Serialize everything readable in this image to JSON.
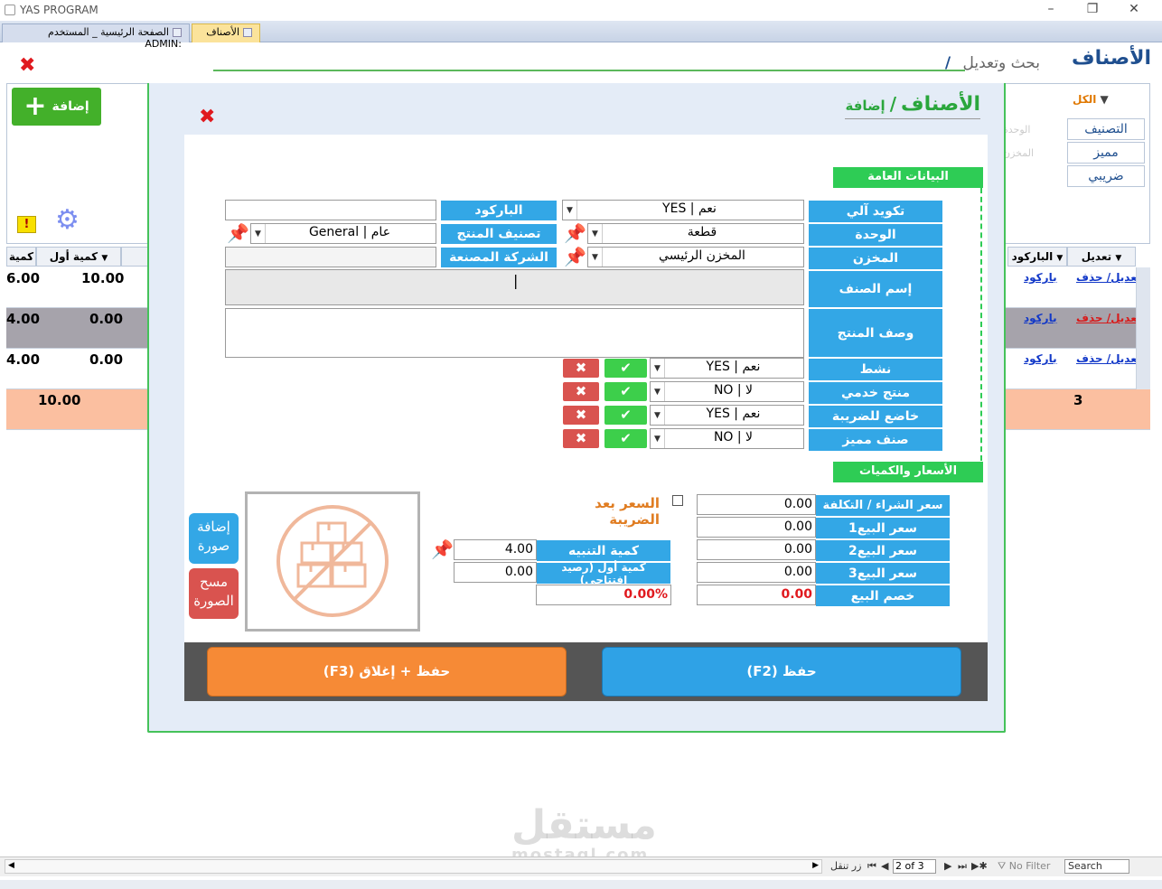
{
  "window": {
    "title": "YAS PROGRAM"
  },
  "tabs": [
    {
      "label": "الصفحة الرئيسية _ المستخدم :ADMIN"
    },
    {
      "label": "الأصناف"
    }
  ],
  "background": {
    "title": "الأصناف",
    "subtitle": "بحث وتعديل",
    "separator": "/",
    "add_label": "إضافة",
    "filter_all": "الكل",
    "categories": [
      "التصنيف",
      "مميز",
      "ضريبي"
    ],
    "faint_headers": [
      "الوحدة",
      "المخزن"
    ],
    "grid_headers": {
      "edit": "تعديل",
      "barcode": "الباركود",
      "qty_first": "كمية أول",
      "qty": "كمية"
    },
    "rows": [
      {
        "edit_link": "تعديل/ حذف",
        "barcode_link": "باركود",
        "qty_first": "10.00",
        "qty": "6.00"
      },
      {
        "edit_link": "تعديل/ حذف",
        "barcode_link": "باركود",
        "qty_first": "0.00",
        "qty": "4.00"
      },
      {
        "edit_link": "تعديل/ حذف",
        "barcode_link": "باركود",
        "qty_first": "0.00",
        "qty": "4.00"
      }
    ],
    "total_row": {
      "count": "3",
      "qty_first": "10.00"
    }
  },
  "navbar": {
    "label": "زر تنقل",
    "position": "2 of 3",
    "filter": "No Filter",
    "search": "Search"
  },
  "watermark": {
    "ar": "مستقل",
    "en": "mostaql.com"
  },
  "modal": {
    "title": "الأصناف",
    "separator": "/",
    "subtitle": "إضافة",
    "section_general": "البيانات العامة",
    "section_prices": "الأسعار والكميات",
    "fields": {
      "auto_code": {
        "label": "تكويد آلي",
        "value": "نعم | YES"
      },
      "barcode": {
        "label": "الباركود",
        "value": ""
      },
      "unit": {
        "label": "الوحدة",
        "value": "قطعة"
      },
      "category": {
        "label": "تصنيف المنتج",
        "value": "عام | General"
      },
      "store": {
        "label": "المخزن",
        "value": "المخزن الرئيسي"
      },
      "manufacturer": {
        "label": "الشركة المصنعة",
        "value": ""
      },
      "item_name": {
        "label": "إسم الصنف",
        "value": ""
      },
      "item_desc": {
        "label": "وصف المنتج",
        "value": ""
      },
      "active": {
        "label": "نشط",
        "value": "نعم | YES"
      },
      "service": {
        "label": "منتج خدمي",
        "value": "لا | NO"
      },
      "taxable": {
        "label": "خاضع للضريبة",
        "value": "نعم | YES"
      },
      "featured": {
        "label": "صنف مميز",
        "value": "لا | NO"
      }
    },
    "prices": {
      "cost": {
        "label": "سعر الشراء / التكلفة",
        "value": "0.00"
      },
      "sale1": {
        "label": "سعر البيع1",
        "value": "0.00"
      },
      "sale2": {
        "label": "سعر البيع2",
        "value": "0.00"
      },
      "sale3": {
        "label": "سعر البيع3",
        "value": "0.00"
      },
      "discount": {
        "label": "خصم البيع",
        "value": "0.00"
      }
    },
    "qty": {
      "alert": {
        "label": "كمية التنبيه",
        "value": "4.00"
      },
      "opening": {
        "label": "كمية أول (رصيد إفتتاحي)",
        "value": "0.00"
      },
      "percent": "0.00%"
    },
    "tax_after_label": "السعر بعد الضريبة",
    "image_add": "إضافة صورة",
    "image_delete": "مسح الصورة",
    "save_label": "حفظ (F2)",
    "save_close_label": "حفظ + إغلاق (F3)",
    "check_mark": "✔",
    "x_mark": "✖"
  },
  "colors": {
    "accent_green": "#2ecc55",
    "label_blue": "#33a7e6",
    "orange": "#f68a36",
    "danger": "#d9534f"
  }
}
